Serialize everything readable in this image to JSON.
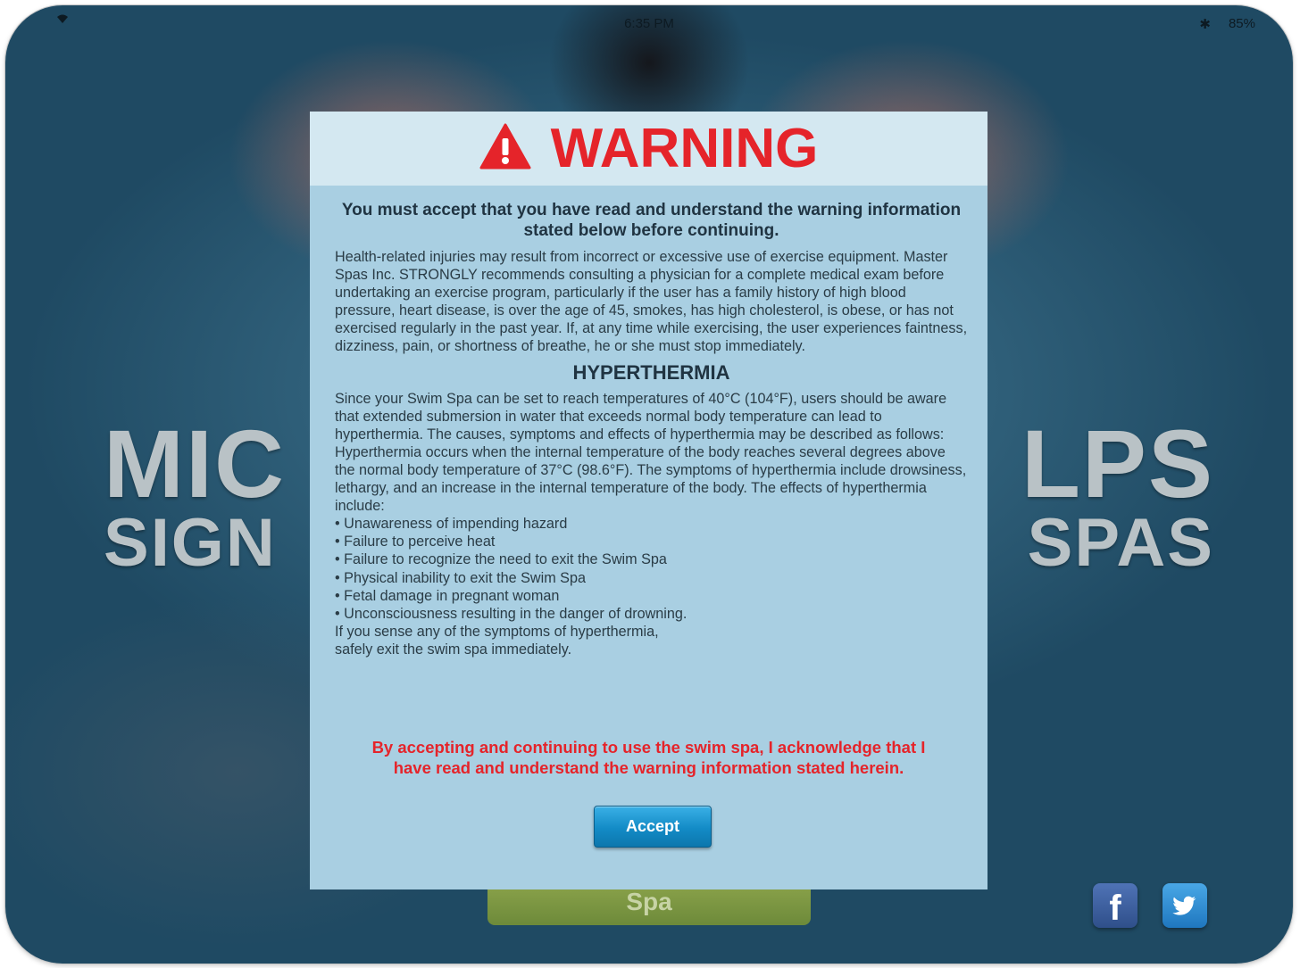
{
  "status_bar": {
    "time": "6:35 PM",
    "battery": "85%"
  },
  "background": {
    "left_line1": "MIC",
    "left_line2": "SIGN",
    "right_line1": "LPS",
    "right_line2": "SPAS",
    "spa_button": "Spa"
  },
  "social": {
    "facebook_glyph": "f",
    "facebook_icon": "facebook-icon",
    "twitter_icon": "twitter-icon"
  },
  "modal": {
    "title": "WARNING",
    "lead": "You must accept that you have read and understand the warning information stated below before continuing.",
    "intro": "Health-related injuries may result from incorrect or excessive use of exercise equipment. Master Spas Inc. STRONGLY recommends consulting a physician for a complete medical exam before undertaking an exercise program, particularly if the user has a family history of high blood pressure, heart disease, is over the age of 45, smokes, has high cholesterol, is obese, or has not exercised regularly in the past year. If, at any time while exercising, the user experiences faintness, dizziness, pain, or shortness of breathe, he or she must stop immediately.",
    "section_title": "HYPERTHERMIA",
    "section_p1": "Since your Swim Spa can be set to reach temperatures of 40°C (104°F), users should be aware that extended submersion in water that exceeds normal body temperature can lead to hyperthermia. The causes, symptoms and effects of hyperthermia may be described as follows:",
    "section_p2": "Hyperthermia occurs when the internal temperature of the body reaches several degrees above the normal body temperature of 37°C (98.6°F). The symptoms of hyperthermia include drowsiness, lethargy, and an increase in the internal temperature of the body. The effects of hyperthermia include:",
    "bullets": [
      "Unawareness of impending hazard",
      "Failure to perceive heat",
      "Failure to recognize the need to exit the Swim Spa",
      "Physical inability to exit the Swim Spa",
      "Fetal damage in pregnant woman",
      "Unconsciousness resulting in the danger of drowning."
    ],
    "closing_line1": "If you sense any of the symptoms of hyperthermia,",
    "closing_line2": "safely exit the swim spa immediately.",
    "ack_line1": "By accepting and continuing to use the swim spa, I acknowledge that I",
    "ack_line2": "have read and understand the warning information stated herein.",
    "accept_label": "Accept",
    "colors": {
      "warning_red": "#e5242a",
      "panel": "#a9cfe2",
      "header": "#d4e8f1",
      "accept_blue": "#138bc6"
    }
  }
}
